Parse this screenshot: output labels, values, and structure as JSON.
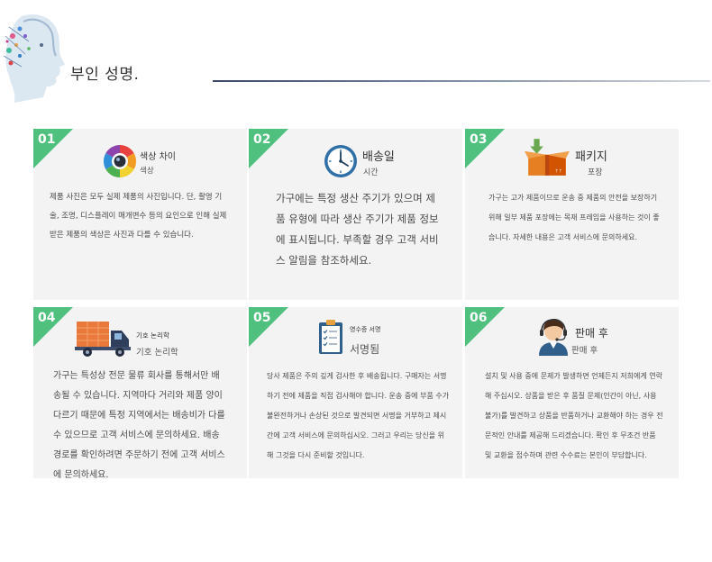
{
  "header": {
    "title": "부인 성명."
  },
  "cards": [
    {
      "num": "01",
      "title": "색상 차이",
      "subtitle": "색상",
      "icon": "camera-lens-icon",
      "body": "제품 사진은 모두 실제 제품의 사진입니다. 단, 촬영 기술, 조명, 디스플레이 매개변수 등의 요인으로 인해 실제 받은 제품의 색상은 사진과 다를 수 있습니다."
    },
    {
      "num": "02",
      "title": "배송일",
      "subtitle": "시간",
      "icon": "clock-icon",
      "body": "가구에는 특정 생산 주기가 있으며 제품 유형에 따라 생산 주기가 제품 정보에 표시됩니다. 부족할 경우 고객 서비스 알림을 참조하세요."
    },
    {
      "num": "03",
      "title": "패키지",
      "subtitle": "포장",
      "icon": "package-box-icon",
      "body": "가구는 고가 제품이므로 운송 중 제품의 안전을 보장하기 위해 일부 제품 포장에는 목재 프레임을 사용하는 것이 좋습니다. 자세한 내용은 고객 서비스에 문의하세요."
    },
    {
      "num": "04",
      "title": "기호 논리학",
      "subtitle": "기호 논리학",
      "icon": "delivery-truck-icon",
      "body": "가구는 특성상 전문 물류 회사를 통해서만 배송될 수 있습니다. 지역마다 거리와 제품 양이 다르기 때문에 특정 지역에서는 배송비가 다를 수 있으므로 고객 서비스에 문의하세요. 배송 경로를 확인하려면 주문하기 전에 고객 서비스에 문의하세요."
    },
    {
      "num": "05",
      "title": "영수증 서명",
      "subtitle": "서명됨",
      "icon": "clipboard-checklist-icon",
      "body": "당사 제품은 주의 깊게 검사한 후 배송됩니다. 구매자는 서명하기 전에 제품을 직접 검사해야 합니다. 운송 중에 부품 수가 불완전하거나 손상된 것으로 발견되면 서명을 거부하고 제시간에 고객 서비스에 문의하십시오. 그러고 우리는 당신을 위해 그것을 다시 준비할 것입니다."
    },
    {
      "num": "06",
      "title": "판매 후",
      "subtitle": "판매 후",
      "icon": "support-agent-icon",
      "body": "설치 및 사용 중에 문제가 발생하면 언제든지 저희에게 연락해 주십시오. 상품을 받은 후 품질 문제(인간이 아닌, 사용 불가)를 발견하고 상품을 반품하거나 교환해야 하는 경우 전문적인 안내를 제공해 드리겠습니다. 확인 후 무조건 반품 및 교환을 접수하며 관련 수수료는 본인이 부담합니다."
    }
  ]
}
